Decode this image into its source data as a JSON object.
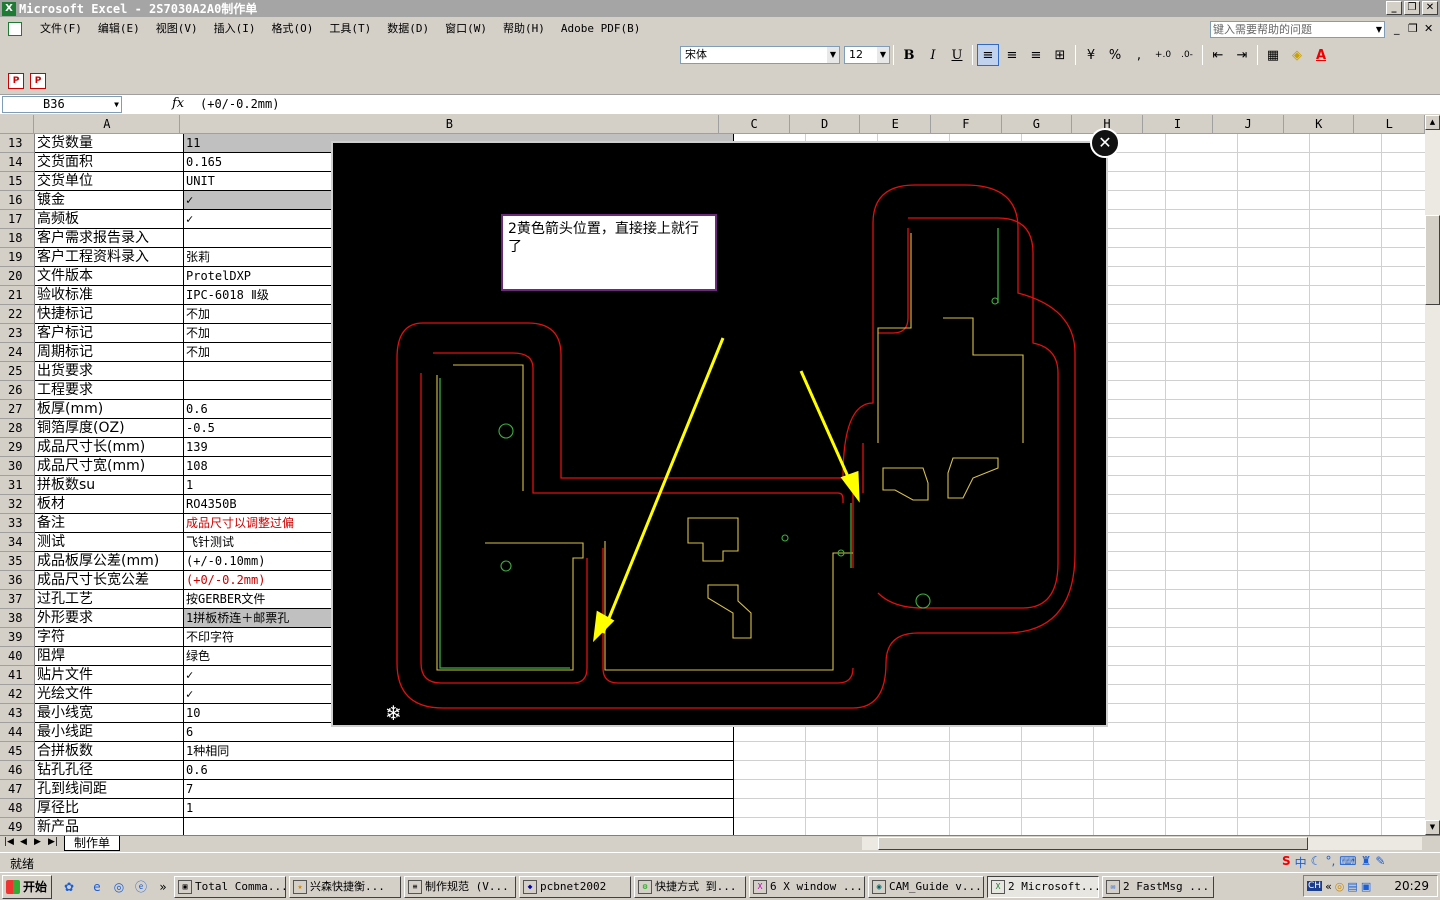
{
  "window": {
    "title": "Microsoft Excel - 2S7030A2A0制作单",
    "app_icon": "X",
    "buttons": [
      "_",
      "❐",
      "✕"
    ]
  },
  "menu": {
    "items": [
      "文件(F)",
      "编辑(E)",
      "视图(V)",
      "插入(I)",
      "格式(O)",
      "工具(T)",
      "数据(D)",
      "窗口(W)",
      "帮助(H)",
      "Adobe PDF(B)"
    ],
    "help_placeholder": "键入需要帮助的问题"
  },
  "format_toolbar": {
    "font": "宋体",
    "size": "12",
    "bold": "B",
    "italic": "I",
    "underline": "U",
    "percent": "%",
    "comma": ","
  },
  "formula_bar": {
    "name_box": "B36",
    "fx": "fx",
    "formula": "(+0/-0.2mm)"
  },
  "columns": [
    "A",
    "B",
    "C",
    "D",
    "E",
    "F",
    "G",
    "H",
    "I",
    "J",
    "K",
    "L"
  ],
  "rows": [
    {
      "n": "13",
      "a": "交货数量",
      "b": "11",
      "style": "gray"
    },
    {
      "n": "14",
      "a": "交货面积",
      "b": "0.165",
      "style": ""
    },
    {
      "n": "15",
      "a": "交货单位",
      "b": "UNIT",
      "style": ""
    },
    {
      "n": "16",
      "a": "镀金",
      "b": "✓",
      "style": "gray"
    },
    {
      "n": "17",
      "a": "高频板",
      "b": "✓",
      "style": ""
    },
    {
      "n": "18",
      "a": "客户需求报告录入",
      "b": "",
      "style": ""
    },
    {
      "n": "19",
      "a": "客户工程资料录入",
      "b": "张莉",
      "style": ""
    },
    {
      "n": "20",
      "a": "文件版本",
      "b": "ProtelDXP",
      "style": ""
    },
    {
      "n": "21",
      "a": "验收标准",
      "b": "IPC-6018 Ⅱ级",
      "style": ""
    },
    {
      "n": "22",
      "a": "快捷标记",
      "b": "不加",
      "style": ""
    },
    {
      "n": "23",
      "a": "客户标记",
      "b": "不加",
      "style": ""
    },
    {
      "n": "24",
      "a": "周期标记",
      "b": "不加",
      "style": ""
    },
    {
      "n": "25",
      "a": "出货要求",
      "b": "",
      "style": ""
    },
    {
      "n": "26",
      "a": "工程要求",
      "b": "",
      "style": ""
    },
    {
      "n": "27",
      "a": "板厚(mm)",
      "b": "0.6",
      "style": ""
    },
    {
      "n": "28",
      "a": "铜箔厚度(OZ)",
      "b": "-0.5",
      "style": ""
    },
    {
      "n": "29",
      "a": "成品尺寸长(mm)",
      "b": "139",
      "style": ""
    },
    {
      "n": "30",
      "a": "成品尺寸宽(mm)",
      "b": "108",
      "style": ""
    },
    {
      "n": "31",
      "a": "拼板数su",
      "b": "1",
      "style": ""
    },
    {
      "n": "32",
      "a": "板材",
      "b": "RO4350B",
      "style": ""
    },
    {
      "n": "33",
      "a": "备注",
      "b": "成品尺寸以调整过偏",
      "style": "red"
    },
    {
      "n": "34",
      "a": "测试",
      "b": "飞针测试",
      "style": ""
    },
    {
      "n": "35",
      "a": "成品板厚公差(mm)",
      "b": "(+/-0.10mm)",
      "style": ""
    },
    {
      "n": "36",
      "a": "成品尺寸长宽公差",
      "b": "(+0/-0.2mm)",
      "style": "red"
    },
    {
      "n": "37",
      "a": "过孔工艺",
      "b": "按GERBER文件",
      "style": ""
    },
    {
      "n": "38",
      "a": "外形要求",
      "b": "1拼板桥连＋邮票孔",
      "style": "gray"
    },
    {
      "n": "39",
      "a": "字符",
      "b": "不印字符",
      "style": ""
    },
    {
      "n": "40",
      "a": "阻焊",
      "b": "绿色",
      "style": ""
    },
    {
      "n": "41",
      "a": "贴片文件",
      "b": "✓",
      "style": ""
    },
    {
      "n": "42",
      "a": "光绘文件",
      "b": "✓",
      "style": ""
    },
    {
      "n": "43",
      "a": "最小线宽",
      "b": "10",
      "style": ""
    },
    {
      "n": "44",
      "a": "最小线距",
      "b": "6",
      "style": ""
    },
    {
      "n": "45",
      "a": "合拼板数",
      "b": "1种相同",
      "style": ""
    },
    {
      "n": "46",
      "a": "钻孔孔径",
      "b": "0.6",
      "style": ""
    },
    {
      "n": "47",
      "a": "孔到线间距",
      "b": "7",
      "style": ""
    },
    {
      "n": "48",
      "a": "厚径比",
      "b": "1",
      "style": ""
    },
    {
      "n": "49",
      "a": "新产品",
      "b": "",
      "style": ""
    }
  ],
  "sheet_tab": "制作单",
  "status": "就绪",
  "popup": {
    "note": "2黄色箭头位置，直接接上就行了",
    "close": "✕",
    "colors": {
      "outline": "#e01010",
      "trace": "#d9c24a",
      "arrow": "#ffff00",
      "green": "#3fae3f"
    }
  },
  "taskbar": {
    "start": "开始",
    "tasks": [
      {
        "label": "Total Comma...",
        "icon": "disk-icon"
      },
      {
        "label": "兴森快捷衡...",
        "icon": "star-icon"
      },
      {
        "label": "制作规范 (V...",
        "icon": "doc-icon"
      },
      {
        "label": "pcbnet2002",
        "icon": "app-icon"
      },
      {
        "label": "快捷方式 到...",
        "icon": "link-icon"
      },
      {
        "label": "6 X window ...",
        "icon": "x-icon"
      },
      {
        "label": "CAM_Guide v...",
        "icon": "cam-icon"
      },
      {
        "label": "2 Microsoft...",
        "icon": "excel-icon"
      },
      {
        "label": "2 FastMsg ...",
        "icon": "msg-icon"
      }
    ],
    "clock": "20:29",
    "ime": "中"
  }
}
